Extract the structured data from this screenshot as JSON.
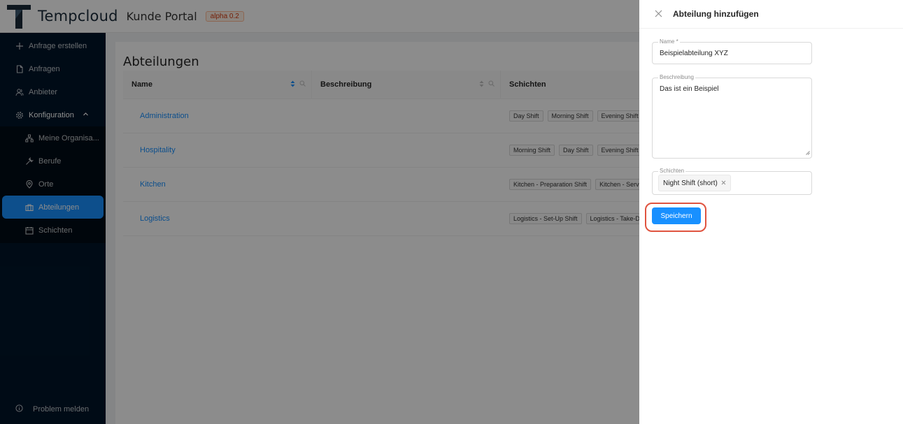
{
  "header": {
    "brand": "Tempcloud",
    "portal": "Kunde Portal",
    "version_badge": "alpha 0.2"
  },
  "sidebar": {
    "items": [
      {
        "label": "Anfrage erstellen",
        "icon": "plus-icon"
      },
      {
        "label": "Anfragen",
        "icon": "file-icon"
      },
      {
        "label": "Anbieter",
        "icon": "users-icon"
      },
      {
        "label": "Konfiguration",
        "icon": "gear-icon",
        "expanded": true
      }
    ],
    "sub_items": [
      {
        "label": "Meine Organisa...",
        "icon": "org-icon"
      },
      {
        "label": "Berufe",
        "icon": "tool-icon"
      },
      {
        "label": "Orte",
        "icon": "pin-icon"
      },
      {
        "label": "Abteilungen",
        "icon": "briefcase-icon",
        "active": true
      },
      {
        "label": "Schichten",
        "icon": "calendar-icon"
      }
    ],
    "report": "Problem melden"
  },
  "main": {
    "title": "Abteilungen",
    "columns": [
      "Name",
      "Beschreibung",
      "Schichten"
    ],
    "rows": [
      {
        "name": "Administration",
        "description": "",
        "shifts": [
          "Day Shift",
          "Morning Shift",
          "Evening Shift"
        ]
      },
      {
        "name": "Hospitality",
        "description": "",
        "shifts": [
          "Morning Shift",
          "Day Shift",
          "Evening Shift"
        ]
      },
      {
        "name": "Kitchen",
        "description": "",
        "shifts": [
          "Kitchen - Preparation Shift",
          "Kitchen - Servi"
        ]
      },
      {
        "name": "Logistics",
        "description": "",
        "shifts": [
          "Logistics - Set-Up Shift",
          "Logistics - Take-D"
        ]
      }
    ]
  },
  "drawer": {
    "title": "Abteilung hinzufügen",
    "name_label": "Name *",
    "name_value": "Beispielabteilung XYZ",
    "description_label": "Beschreibung",
    "description_value": "Das ist ein Beispiel",
    "shifts_label": "Schichten",
    "selected_shift": "Night Shift (short)",
    "save_label": "Speichern"
  },
  "colors": {
    "primary": "#1890ff",
    "sidebar": "#001529",
    "highlight": "#e0533f"
  }
}
